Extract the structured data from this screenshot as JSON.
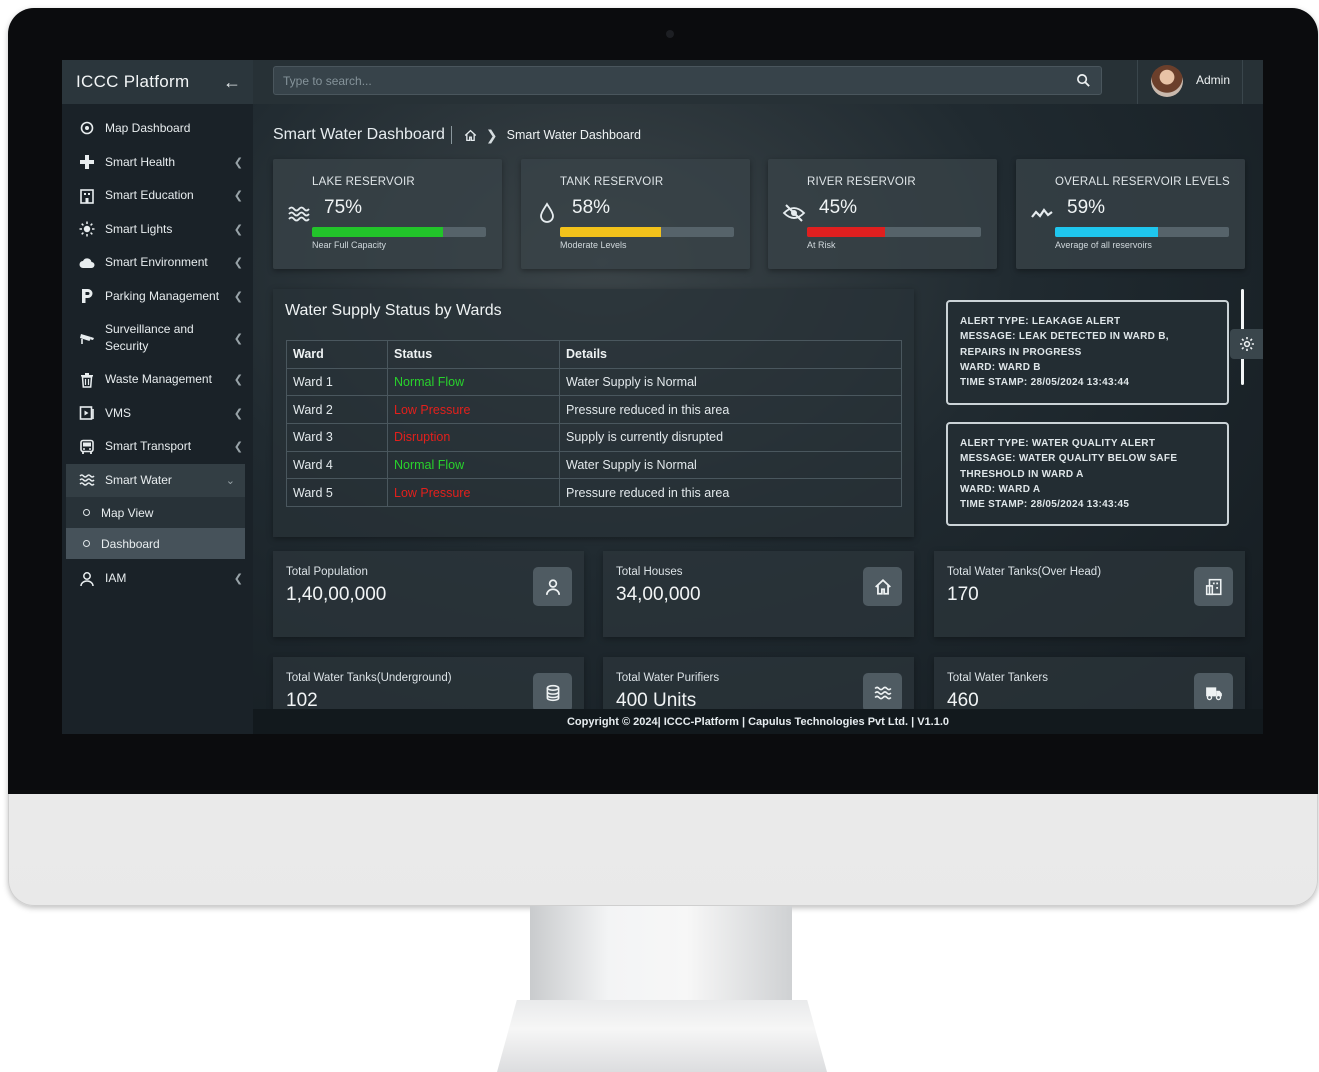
{
  "app": {
    "title": "ICCC Platform",
    "user": "Admin"
  },
  "search": {
    "placeholder": "Type to search..."
  },
  "sidebar": {
    "items": [
      {
        "label": "Map Dashboard"
      },
      {
        "label": "Smart Health"
      },
      {
        "label": "Smart Education"
      },
      {
        "label": "Smart Lights"
      },
      {
        "label": "Smart Environment"
      },
      {
        "label": "Parking Management"
      },
      {
        "label": "Surveillance and Security"
      },
      {
        "label": "Waste Management"
      },
      {
        "label": "VMS"
      },
      {
        "label": "Smart Transport"
      },
      {
        "label": "Smart Water"
      },
      {
        "label": "IAM"
      }
    ],
    "sub_items": [
      {
        "label": "Map View"
      },
      {
        "label": "Dashboard"
      }
    ]
  },
  "page": {
    "title": "Smart Water Dashboard",
    "breadcrumb_current": "Smart Water Dashboard"
  },
  "reservoirs": [
    {
      "title": "LAKE RESERVOIR",
      "value": "75%",
      "level": 0.75,
      "note": "Near Full Capacity",
      "color": "#22c42a",
      "icon": "waves-icon"
    },
    {
      "title": "TANK RESERVOIR",
      "value": "58%",
      "level": 0.58,
      "note": "Moderate Levels",
      "color": "#f3c21b",
      "icon": "droplet-icon"
    },
    {
      "title": "RIVER RESERVOIR",
      "value": "45%",
      "level": 0.45,
      "note": "At Risk",
      "color": "#e01f1f",
      "icon": "eye-slash-icon"
    },
    {
      "title": "OVERALL RESERVOIR LEVELS",
      "value": "59%",
      "level": 0.59,
      "note": "Average of all reservoirs",
      "color": "#1fc6ee",
      "icon": "trend-icon"
    }
  ],
  "ward_table": {
    "title": "Water Supply Status by Wards",
    "headers": [
      "Ward",
      "Status",
      "Details"
    ],
    "rows": [
      {
        "ward": "Ward 1",
        "status": "Normal Flow",
        "details": "Water Supply is Normal"
      },
      {
        "ward": "Ward 2",
        "status": "Low Pressure",
        "details": "Pressure reduced in this area"
      },
      {
        "ward": "Ward 3",
        "status": "Disruption",
        "details": "Supply is currently disrupted"
      },
      {
        "ward": "Ward 4",
        "status": "Normal Flow",
        "details": "Water Supply is Normal"
      },
      {
        "ward": "Ward 5",
        "status": "Low Pressure",
        "details": "Pressure reduced in this area"
      }
    ],
    "status_colors": {
      "normal": "#28d22c",
      "alert": "#e2201c"
    }
  },
  "alerts": [
    {
      "type": "ALERT TYPE: LEAKAGE ALERT",
      "message": "MESSAGE: LEAK DETECTED IN WARD B, REPAIRS IN PROGRESS",
      "ward": "WARD: WARD B",
      "timestamp": "TIME STAMP: 28/05/2024 13:43:44"
    },
    {
      "type": "ALERT TYPE: WATER QUALITY ALERT",
      "message": "MESSAGE: WATER QUALITY BELOW SAFE THRESHOLD IN WARD A",
      "ward": "WARD: WARD A",
      "timestamp": "TIME STAMP: 28/05/2024 13:43:45"
    }
  ],
  "stats": [
    {
      "label": "Total Population",
      "value": "1,40,00,000",
      "icon": "person-icon"
    },
    {
      "label": "Total Houses",
      "value": "34,00,000",
      "icon": "home-icon"
    },
    {
      "label": "Total Water Tanks(Over Head)",
      "value": "170",
      "icon": "building-icon"
    },
    {
      "label": "Total Water Tanks(Underground)",
      "value": "102",
      "icon": "database-icon"
    },
    {
      "label": "Total Water Purifiers",
      "value": "400 Units",
      "icon": "waves-icon"
    },
    {
      "label": "Total Water Tankers",
      "value": "460",
      "icon": "truck-icon"
    }
  ],
  "footer": {
    "text": "Copyright © 2024| ICCC-Platform | Capulus Technologies Pvt Ltd. | V1.1.0"
  }
}
